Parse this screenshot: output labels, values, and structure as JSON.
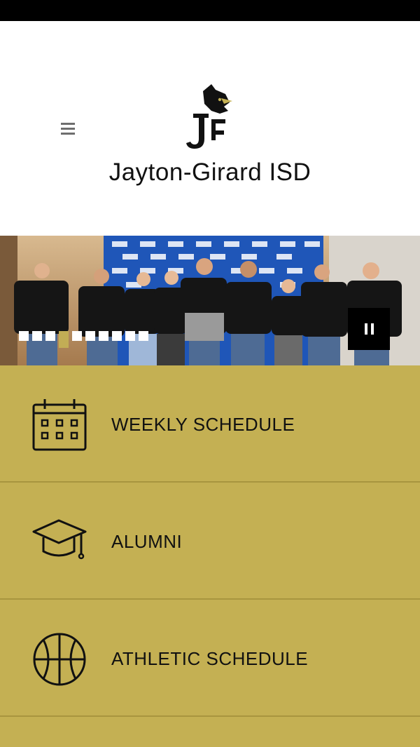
{
  "header": {
    "site_title": "Jayton-Girard ISD",
    "logo_icon": "jayton-jaybird-logo-icon"
  },
  "menu": {
    "icon": "hamburger-menu-icon"
  },
  "slideshow": {
    "slide_count": 10,
    "active_index": 3,
    "pause_icon": "pause-icon"
  },
  "quick_links": [
    {
      "label": "WEEKLY SCHEDULE",
      "icon": "calendar-icon"
    },
    {
      "label": "ALUMNI",
      "icon": "graduation-cap-icon"
    },
    {
      "label": "ATHLETIC SCHEDULE",
      "icon": "basketball-icon"
    }
  ],
  "colors": {
    "accent_gold": "#c4b053",
    "divider": "#a8953f",
    "status_bar": "#000000"
  }
}
